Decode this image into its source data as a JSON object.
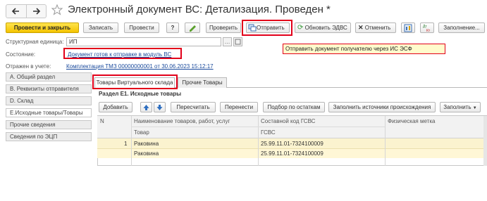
{
  "window": {
    "title": "Электронный документ ВС: Детализация. Проведен *"
  },
  "toolbar": {
    "post_and_close": "Провести и закрыть",
    "write": "Записать",
    "post": "Провести",
    "help": "?",
    "check": "Проверить",
    "send": "Отправить",
    "update_edvs": "Обновить ЭДВС",
    "cancel": "Отменить",
    "fill": "Заполнение..."
  },
  "tooltip": {
    "text": "Отправить документ  получателю через ИС ЭСФ"
  },
  "header": {
    "unit_label": "Структурная единица:",
    "unit_value": "ИП",
    "state_label": "Состояние:",
    "state_value": "Документ готов к отправке в модуль ВС",
    "reflected_label": "Отражен в учете:",
    "reflected_value": "Комплектация ТМЗ 00000000001 от 30.06.2023 15:12:17"
  },
  "nav": {
    "items": [
      {
        "label": "А. Общий раздел"
      },
      {
        "label": "В. Реквизиты отправителя"
      },
      {
        "label": "D. Склад"
      },
      {
        "label": "Е.Исходные товары/Товары"
      },
      {
        "label": "Прочие сведения"
      },
      {
        "label": "Сведения по ЭЦП"
      }
    ]
  },
  "tabs": [
    {
      "label": "Товары Виртуального склада"
    },
    {
      "label": "Прочие Товары"
    }
  ],
  "section": {
    "title": "Раздел Е1. Исходные товары"
  },
  "table_toolbar": {
    "add": "Добавить",
    "recalc": "Пересчитать",
    "move": "Перенести",
    "select_by_stock": "Подбор по остаткам",
    "fill_sources": "Заполнить источники происхождения",
    "fill": "Заполнить"
  },
  "table": {
    "headers": {
      "n": "N",
      "name": "Наименование товаров, работ, услуг",
      "item": "Товар",
      "code": "Составной код ГСВС",
      "code_sub": "ГСВС",
      "mark": "Физическая метка"
    },
    "rows": [
      {
        "n": "1",
        "name": "Раковина",
        "code": "25.99.11.01-7324100009",
        "item": "Раковина",
        "item_code": "25.99.11.01-7324100009"
      }
    ]
  },
  "colors": {
    "accent_yellow": "#f4c300",
    "highlight_row": "#fbf3cf",
    "highlight_row_alt": "#fff7d6",
    "red_frame": "#e2001a",
    "tooltip_bg": "#fffccc",
    "link": "#1a4a9c"
  },
  "icons": {
    "back": "arrow-left-icon",
    "forward": "arrow-right-icon",
    "favorite": "star-icon",
    "pencil": "pencil-icon",
    "send": "send-icon",
    "refresh": "refresh-icon",
    "cancel": "x-icon",
    "report": "report-icon",
    "dtkt": "dt-kt-icon",
    "up": "arrow-up-icon",
    "down": "arrow-down-icon"
  }
}
